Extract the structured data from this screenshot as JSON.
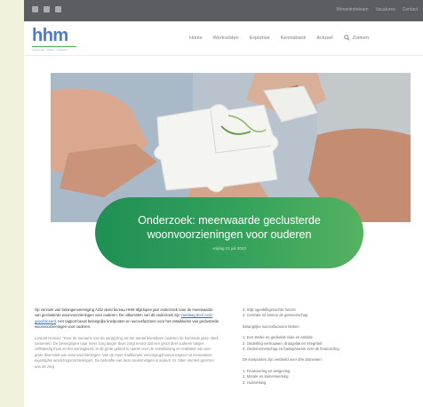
{
  "topbar": {
    "social_icons": [
      "linkedin-icon",
      "mail-icon",
      "twitter-icon"
    ],
    "links": [
      "Wonenindeteam",
      "Vacatures",
      "Contact"
    ]
  },
  "header": {
    "logo_text": "hhm",
    "logo_tagline": "onderzoek · advies · projecten",
    "nav": [
      "Home",
      "Werkvelden",
      "Expertise",
      "Kennisbank",
      "Actueel"
    ],
    "search_label": "Zoeken"
  },
  "article": {
    "title": "Onderzoek: meerwaarde geclusterde woonvoorzieningen voor ouderen",
    "date": "vrijdag 21 juli 2023",
    "intro_before_link": "Op verzoek van belangenvereniging Actiz deed bureau HHM afgelopen jaar onderzoek naar de meerwaarde van geclusterde woonvoorzieningen voor ouderen. De uitkomsten van dit onderzoek zijn ",
    "intro_link": "vandaag door Actiz gepubliceerd",
    "intro_after_link": ". Het rapport bevat belangrijke knelpunten en succesfactoren voor het ontwikkelen van geclusterde woonvoorzieningen voor ouderen.",
    "body": "Lennart Homan: “Door de toename van de vergrijzing zal het aantal kwetsbare ouderen de komende jaren sterk toenemen. De bewegingen naar meer zorg langer thuis zorgt ervoor dat een groot deel ouderen langer zelfstandig thuis en het woningbezit. In dit grote gebied is ruimte voor de ontwikkeling en realisatie van een grote diversiteit aan woonvoorzieningen. Van de meer traditionele verzorgingshuisconcepten tot innovatieve, eigentijdse woonzorgvoorzieningen. De behoefte van deze toekomstigen is anders. Er zitten immers grenzen aan de zorg",
    "right_list_1": [
      "2. Stijk ogenblikgemichte functie",
      "3. Centrale rol binnen de gemeenschap"
    ],
    "right_heading_2": "Belangrijke succesfactoren bleken:",
    "right_list_2": [
      "1. Een sterke en gedeelde visie en ambitie",
      "2. Onderling vertrouwen, draagvlak en integriteit",
      "3. Ondernemerschap en basisparamis over de financiering"
    ],
    "right_heading_3": "De knelpunten zijn verdeeld over drie domeinen:",
    "right_list_3": [
      "1. Financiering en wetgeving",
      "2. Morale en samenwerking",
      "3. Huisvesting"
    ]
  },
  "colors": {
    "topbar": "#5a5e63",
    "logo_blue": "#4d7cc9",
    "banner_green_start": "#1f8f53",
    "banner_green_end": "#55b25f",
    "link_blue": "#2d6fbf"
  }
}
